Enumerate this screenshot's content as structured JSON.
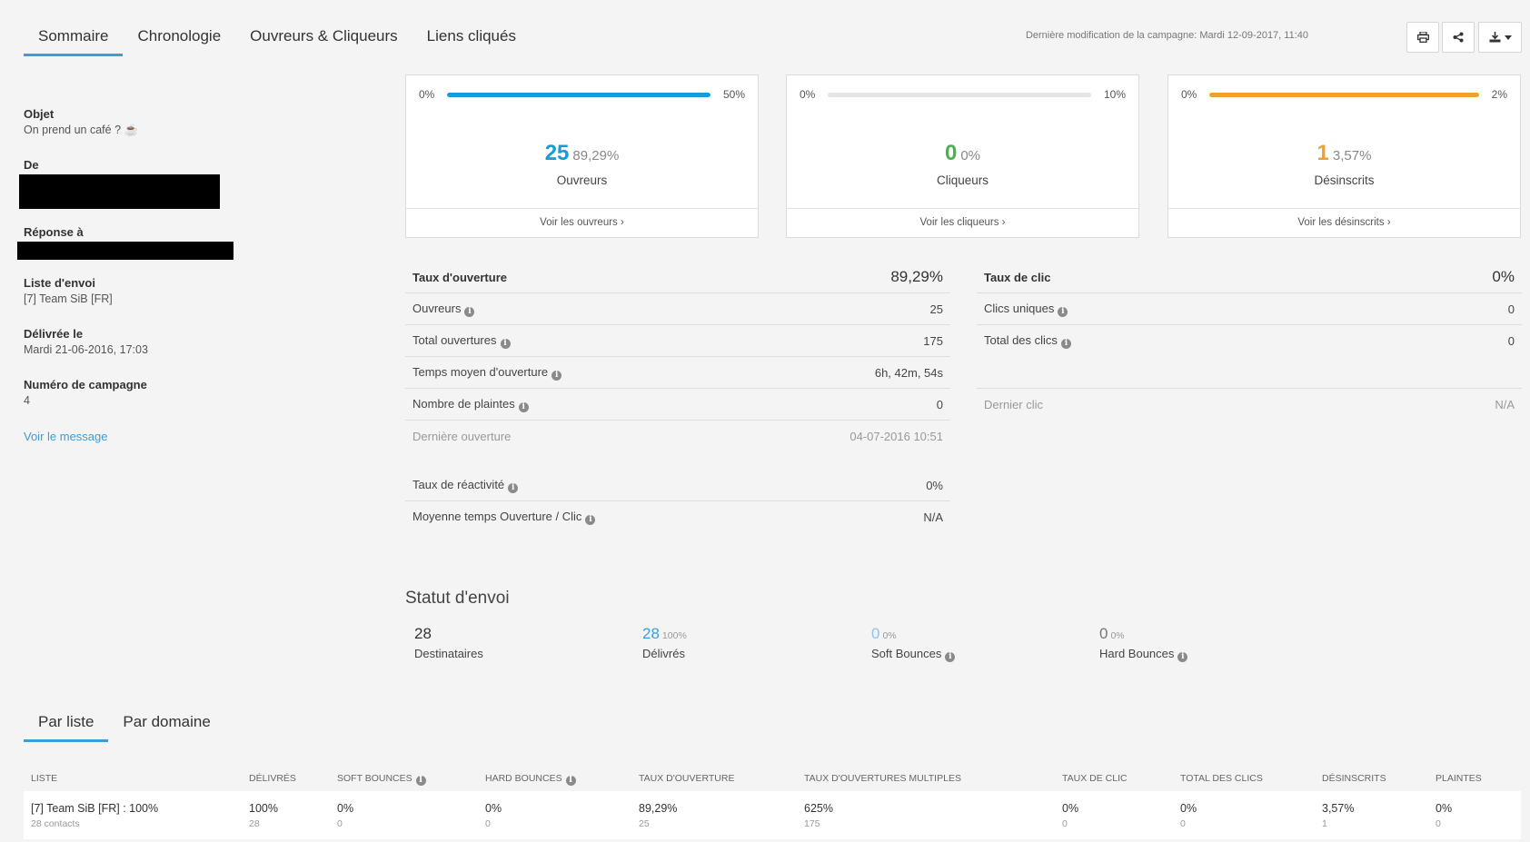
{
  "tabs": [
    "Sommaire",
    "Chronologie",
    "Ouvreurs & Cliqueurs",
    "Liens cliqués"
  ],
  "last_modified": {
    "label": "Dernière modification de la campagne:",
    "value": "Mardi 12-09-2017, 11:40"
  },
  "toolbar": {
    "print_icon": "print-icon",
    "share_icon": "share-icon",
    "export_icon": "download-icon"
  },
  "details": {
    "objet_label": "Objet",
    "objet_value": "On prend un café ? ☕",
    "de_label": "De",
    "reponse_label": "Réponse à",
    "liste_label": "Liste d'envoi",
    "liste_value": "[7] Team SiB [FR]",
    "delivree_label": "Délivrée le",
    "delivree_value": "Mardi 21-06-2016, 17:03",
    "numero_label": "Numéro de campagne",
    "numero_value": "4",
    "view_message": "Voir le message"
  },
  "cards": [
    {
      "min": "0%",
      "max": "50%",
      "fill_fraction": 1.0,
      "color": "#1a9ad6",
      "value": "25",
      "pct": "89,29%",
      "caption": "Ouvreurs",
      "link": "Voir les ouvreurs ›"
    },
    {
      "min": "0%",
      "max": "10%",
      "fill_fraction": 0.0,
      "color": "#4caf50",
      "value": "0",
      "pct": "0%",
      "caption": "Cliqueurs",
      "link": "Voir les cliqueurs ›"
    },
    {
      "min": "0%",
      "max": "2%",
      "fill_fraction": 1.0,
      "color": "#f0a030",
      "value": "1",
      "pct": "3,57%",
      "caption": "Désinscrits",
      "link": "Voir les désinscrits ›"
    }
  ],
  "open_metrics": {
    "head_label": "Taux d'ouverture",
    "head_value": "89,29%",
    "ouvreurs_label": "Ouvreurs",
    "ouvreurs_value": "25",
    "total_label": "Total ouvertures",
    "total_value": "175",
    "temps_label": "Temps moyen d'ouverture",
    "temps_value": "6h, 42m, 54s",
    "plaintes_label": "Nombre de plaintes",
    "plaintes_value": "0",
    "derniere_label": "Dernière ouverture",
    "derniere_value": "04-07-2016 10:51",
    "reactivite_label": "Taux de réactivité",
    "reactivite_value": "0%",
    "moyenne_label": "Moyenne temps Ouverture / Clic",
    "moyenne_value": "N/A"
  },
  "click_metrics": {
    "head_label": "Taux de clic",
    "head_value": "0%",
    "uniques_label": "Clics uniques",
    "uniques_value": "0",
    "total_label": "Total des clics",
    "total_value": "0",
    "dernier_label": "Dernier clic",
    "dernier_value": "N/A"
  },
  "send_status": {
    "title": "Statut d'envoi",
    "items": [
      {
        "value": "28",
        "pct": "",
        "label": "Destinataires"
      },
      {
        "value": "28",
        "pct": "100%",
        "label": "Délivrés"
      },
      {
        "value": "0",
        "pct": "0%",
        "label": "Soft Bounces"
      },
      {
        "value": "0",
        "pct": "0%",
        "label": "Hard Bounces"
      }
    ]
  },
  "subtabs": [
    "Par liste",
    "Par domaine"
  ],
  "table": {
    "headers": [
      "Liste",
      "Délivrés",
      "Soft bounces",
      "Hard bounces",
      "Taux d'ouverture",
      "Taux d'ouvertures multiples",
      "Taux de clic",
      "Total des clics",
      "Désinscrits",
      "Plaintes"
    ],
    "row": {
      "liste": "[7] Team SiB [FR] : 100%",
      "liste_sub": "28 contacts",
      "delivres": "100%",
      "delivres_sub": "28",
      "soft": "0%",
      "soft_sub": "0",
      "hard": "0%",
      "hard_sub": "0",
      "ouverture": "89,29%",
      "ouverture_sub": "25",
      "multiples": "625%",
      "multiples_sub": "175",
      "clic": "0%",
      "clic_sub": "0",
      "total_clics": "0%",
      "total_clics_sub": "0",
      "desinscrits": "3,57%",
      "desinscrits_sub": "1",
      "plaintes": "0%",
      "plaintes_sub": "0"
    }
  }
}
